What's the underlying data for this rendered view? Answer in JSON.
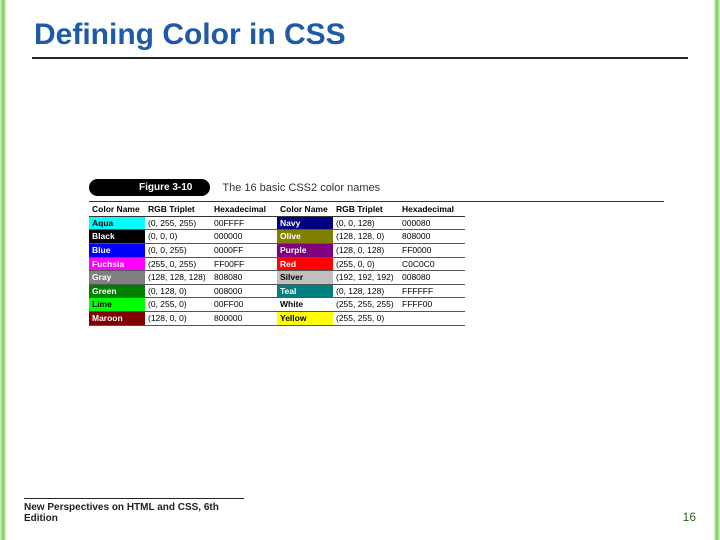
{
  "title": "Defining Color in CSS",
  "figure": {
    "label": "Figure 3-10",
    "caption": "The 16 basic CSS2 color names"
  },
  "headers": {
    "color_name": "Color Name",
    "rgb": "RGB Triplet",
    "hex": "Hexadecimal"
  },
  "colors_left": [
    {
      "name": "Aqua",
      "rgb": "(0, 255, 255)",
      "hex": "00FFFF",
      "bg": "#00ffff",
      "dark": true
    },
    {
      "name": "Black",
      "rgb": "(0, 0, 0)",
      "hex": "000000",
      "bg": "#000000",
      "dark": false
    },
    {
      "name": "Blue",
      "rgb": "(0, 0, 255)",
      "hex": "0000FF",
      "bg": "#0000ff",
      "dark": false
    },
    {
      "name": "Fuchsia",
      "rgb": "(255, 0, 255)",
      "hex": "FF00FF",
      "bg": "#ff00ff",
      "dark": false
    },
    {
      "name": "Gray",
      "rgb": "(128, 128, 128)",
      "hex": "808080",
      "bg": "#808080",
      "dark": false
    },
    {
      "name": "Green",
      "rgb": "(0, 128, 0)",
      "hex": "008000",
      "bg": "#008000",
      "dark": false
    },
    {
      "name": "Lime",
      "rgb": "(0, 255, 0)",
      "hex": "00FF00",
      "bg": "#00ff00",
      "dark": true
    },
    {
      "name": "Maroon",
      "rgb": "(128, 0, 0)",
      "hex": "800000",
      "bg": "#800000",
      "dark": false
    }
  ],
  "colors_right": [
    {
      "name": "Navy",
      "rgb": "(0, 0, 128)",
      "hex": "000080",
      "bg": "#000080",
      "dark": false
    },
    {
      "name": "Olive",
      "rgb": "(128, 128, 0)",
      "hex": "808000",
      "bg": "#808000",
      "dark": false
    },
    {
      "name": "Purple",
      "rgb": "(128, 0, 128)",
      "hex": "FF0000",
      "bg": "#800080",
      "dark": false
    },
    {
      "name": "Red",
      "rgb": "(255, 0, 0)",
      "hex": "C0C0C0",
      "bg": "#ff0000",
      "dark": false
    },
    {
      "name": "Silver",
      "rgb": "(192, 192, 192)",
      "hex": "008080",
      "bg": "#c0c0c0",
      "dark": true
    },
    {
      "name": "Teal",
      "rgb": "(0, 128, 128)",
      "hex": "FFFFFF",
      "bg": "#008080",
      "dark": false
    },
    {
      "name": "White",
      "rgb": "(255, 255, 255)",
      "hex": "FFFF00",
      "bg": "#ffffff",
      "dark": true
    },
    {
      "name": "Yellow",
      "rgb": "(255, 255, 0)",
      "hex": "",
      "bg": "#ffff00",
      "dark": true
    }
  ],
  "footer": {
    "book": "New Perspectives on HTML and CSS, 6th Edition",
    "page": "16"
  }
}
